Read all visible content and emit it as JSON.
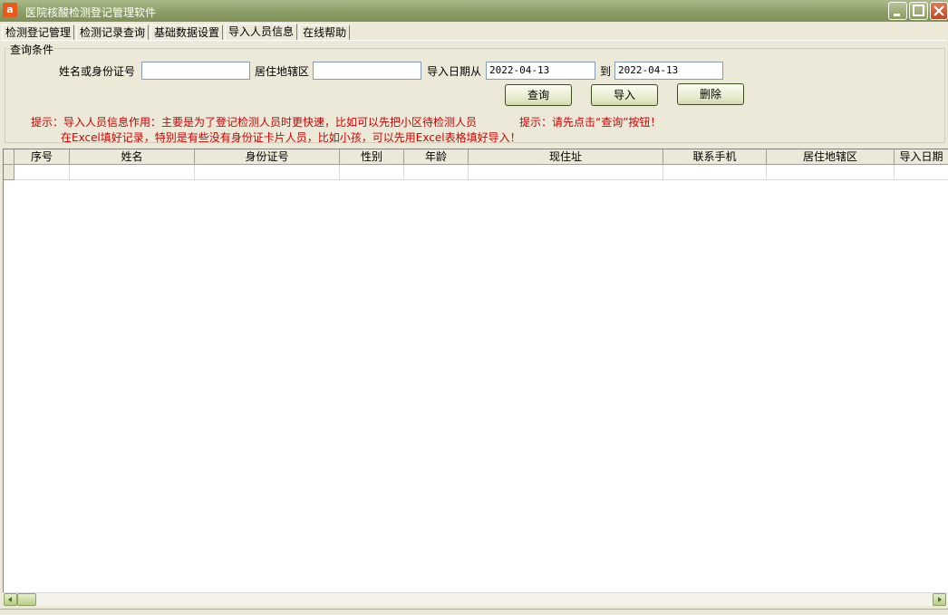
{
  "window": {
    "title": "医院核酸检测登记管理软件",
    "icon_name": "app-icon",
    "icon_glyph": "a"
  },
  "tabs": [
    {
      "label": "检测登记管理",
      "active": false
    },
    {
      "label": "检测记录查询",
      "active": false
    },
    {
      "label": "基础数据设置",
      "active": false
    },
    {
      "label": "导入人员信息",
      "active": true
    },
    {
      "label": "在线帮助",
      "active": false
    }
  ],
  "query": {
    "group_title": "查询条件",
    "name_id_label": "姓名或身份证号",
    "name_id_value": "",
    "district_label": "居住地辖区",
    "district_value": "",
    "date_from_label": "导入日期从",
    "date_from_value": "2022-04-13",
    "date_to_label": "到",
    "date_to_value": "2022-04-13",
    "query_button": "查询",
    "import_button": "导入",
    "delete_button": "删除"
  },
  "hints": {
    "line1": "提示：导入人员信息作用：主要是为了登记检测人员时更快速，比如可以先把小区待检测人员",
    "line2": "在Excel填好记录，特别是有些没有身份证卡片人员，比如小孩，可以先用Excel表格填好导入！",
    "right": "提示：请先点击“查询”按钮！"
  },
  "table": {
    "columns": [
      "序号",
      "姓名",
      "身份证号",
      "性别",
      "年龄",
      "现住址",
      "联系手机",
      "居住地辖区",
      "导入日期"
    ],
    "rows": []
  },
  "colors": {
    "hint_red": "#d00000",
    "titlebar": "#8c9e66",
    "background": "#ece9d8"
  }
}
